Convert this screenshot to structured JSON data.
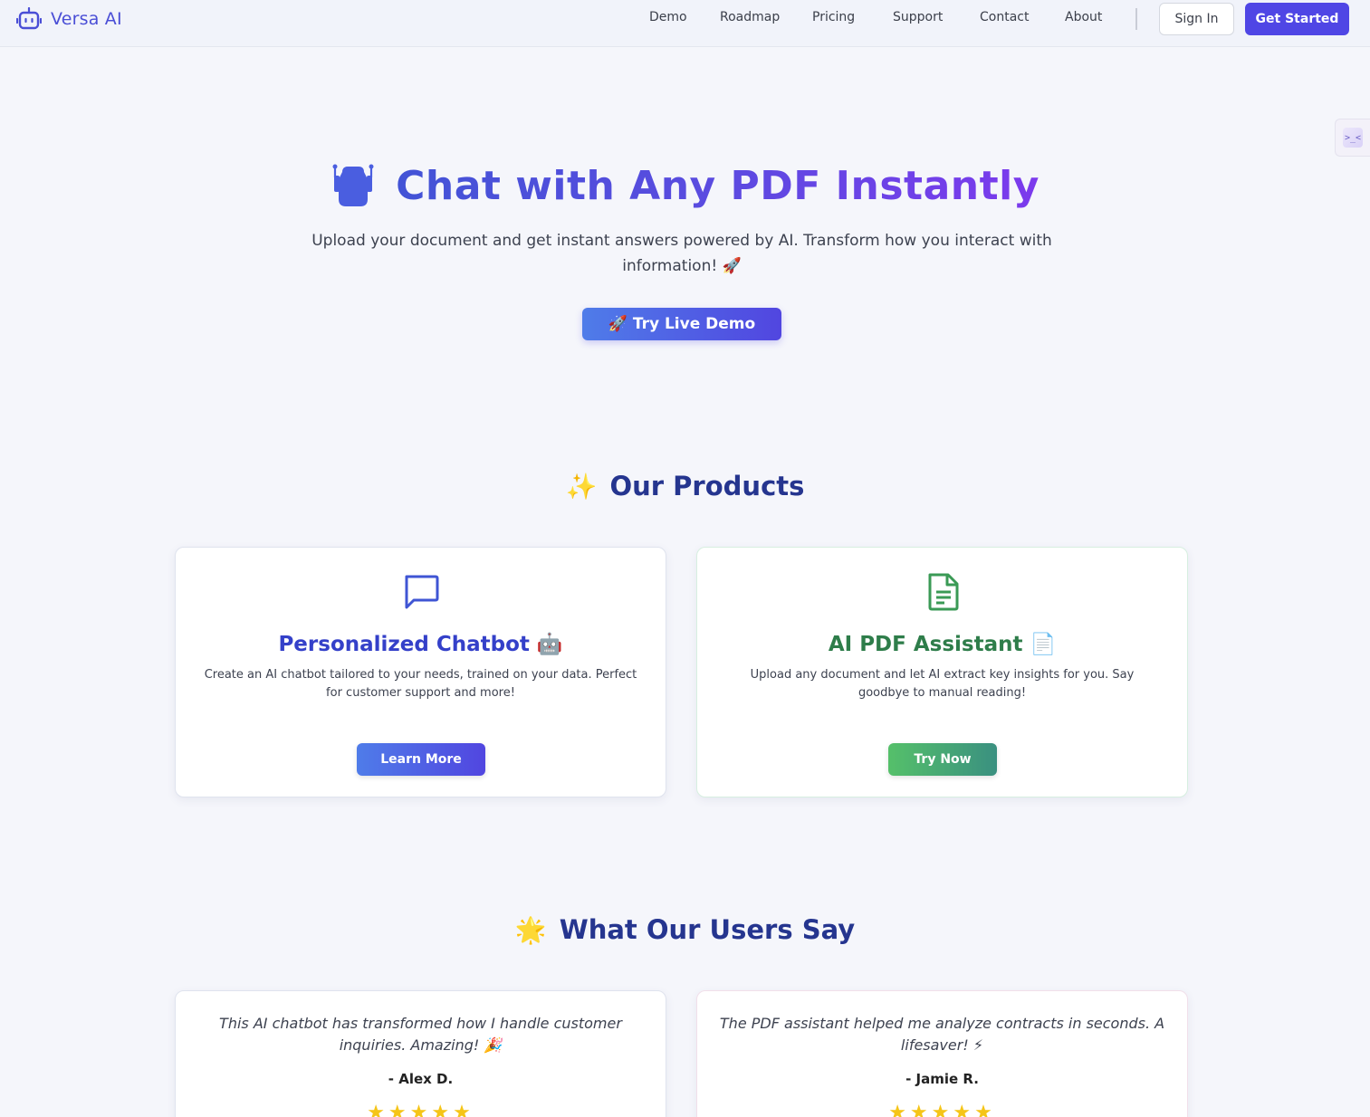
{
  "header": {
    "logo_text": "Versa AI",
    "nav": [
      {
        "label": "Demo"
      },
      {
        "label": "Roadmap"
      },
      {
        "label": "Pricing"
      },
      {
        "label": "Support"
      },
      {
        "label": "Contact"
      },
      {
        "label": "About"
      }
    ],
    "sign_in_label": "Sign In",
    "get_started_label": "Get Started"
  },
  "hero": {
    "title": "Chat with Any PDF Instantly",
    "subtitle": "Upload your document and get instant answers powered by AI. Transform how you interact with information! 🚀",
    "cta_label": "🚀 Try Live Demo"
  },
  "products": {
    "section_emoji": "✨",
    "section_title": "Our Products",
    "items": [
      {
        "icon": "chat-bubble-icon",
        "title": "Personalized Chatbot 🤖",
        "description": "Create an AI chatbot tailored to your needs, trained on your data. Perfect for customer support and more!",
        "button_label": "Learn More"
      },
      {
        "icon": "document-icon",
        "title": "AI PDF Assistant 📄",
        "description": "Upload any document and let AI extract key insights for you. Say goodbye to manual reading!",
        "button_label": "Try Now"
      }
    ]
  },
  "testimonials": {
    "section_emoji": "🌟",
    "section_title": "What Our Users Say",
    "items": [
      {
        "quote": "This AI chatbot has transformed how I handle customer inquiries. Amazing! 🎉",
        "author": "- Alex D.",
        "rating": 5,
        "stars": "★★★★★"
      },
      {
        "quote": "The PDF assistant helped me analyze contracts in seconds. A lifesaver! ⚡",
        "author": "- Jamie R.",
        "rating": 5,
        "stars": "★★★★★"
      }
    ]
  },
  "colors": {
    "brand": "#4f46e5",
    "title_blue": "#25358f",
    "green": "#2e7d4a",
    "star": "#f5c518"
  }
}
